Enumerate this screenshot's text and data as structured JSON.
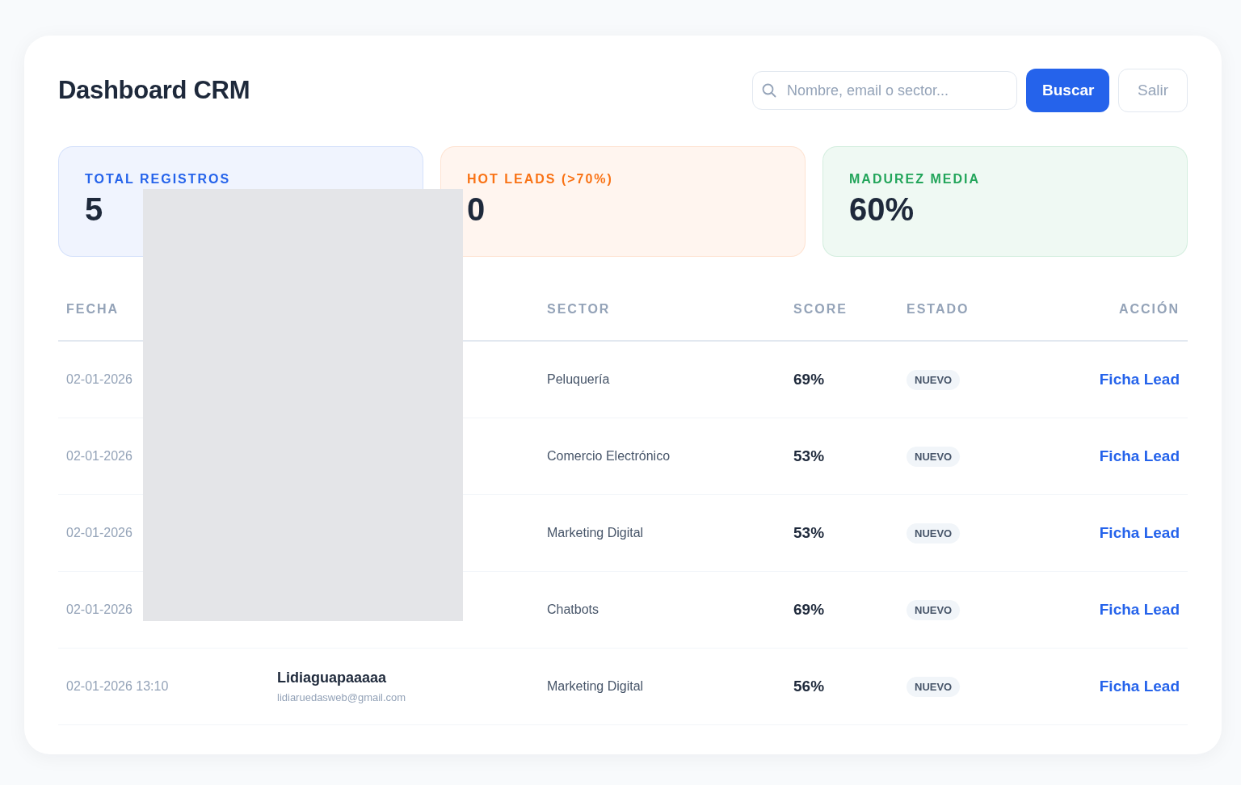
{
  "header": {
    "title": "Dashboard CRM",
    "search": {
      "placeholder": "Nombre, email o sector..."
    },
    "buttons": [
      {
        "label": "Buscar",
        "kind": "primary"
      },
      {
        "label": "Salir",
        "kind": "secondary"
      }
    ]
  },
  "stats": [
    {
      "label": "TOTAL REGISTROS",
      "value": "5",
      "color": "#2563eb"
    },
    {
      "label": "HOT LEADS (>70%)",
      "value": "0",
      "color": "#f97316"
    },
    {
      "label": "MADUREZ MEDIA",
      "value": "60%",
      "color": "#22a55a"
    }
  ],
  "table": {
    "columns": [
      "FECHA",
      "",
      "SECTOR",
      "SCORE",
      "ESTADO",
      "ACCIÓN"
    ],
    "rows": [
      {
        "date": "02-01-2026",
        "sector": "Peluquería",
        "score": "69%",
        "status": "NUEVO",
        "action": "Ficha Lead"
      },
      {
        "date": "02-01-2026",
        "sector": "Comercio Electrónico",
        "score": "53%",
        "status": "NUEVO",
        "action": "Ficha Lead"
      },
      {
        "date": "02-01-2026",
        "sector": "Marketing Digital",
        "score": "53%",
        "status": "NUEVO",
        "action": "Ficha Lead"
      },
      {
        "date": "02-01-2026",
        "sector": "Chatbots",
        "score": "69%",
        "status": "NUEVO",
        "action": "Ficha Lead"
      },
      {
        "date": "02-01-2026 13:10",
        "name": "Lidiaguapaaaaa",
        "email": "lidiaruedasweb@gmail.com",
        "sector": "Marketing Digital",
        "score": "56%",
        "status": "NUEVO",
        "action": "Ficha Lead"
      }
    ]
  },
  "redaction": {
    "kind": "block"
  }
}
